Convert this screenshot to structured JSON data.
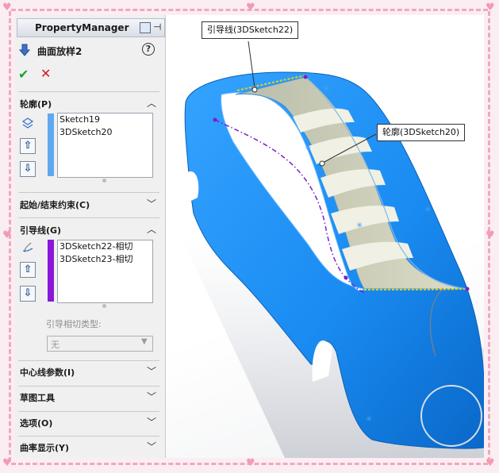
{
  "property_manager": {
    "header_title": "PropertyManager",
    "feature_name": "曲面放样2",
    "help_icon": "?",
    "ok_icon": "✔",
    "cancel_icon": "✕"
  },
  "sections": {
    "profiles": {
      "title": "轮廓(P)",
      "items": [
        "Sketch19",
        "3DSketch20"
      ]
    },
    "start_end_constraints": {
      "title": "起始/结束约束(C)"
    },
    "guide_curves": {
      "title": "引导线(G)",
      "items": [
        "3DSketch22-相切",
        "3DSketch23-相切"
      ],
      "tangency_label": "引导相切类型:",
      "tangency_value": "无"
    },
    "centerline": {
      "title": "中心线参数(I)"
    },
    "sketch_tools": {
      "title": "草图工具"
    },
    "options": {
      "title": "选项(O)"
    },
    "curvature_display": {
      "title": "曲率显示(Y)"
    }
  },
  "callouts": {
    "guide": "引导线(3DSketch22)",
    "profile": "轮廓(3DSketch20)"
  },
  "icons": {
    "feature": "loft-surface-icon",
    "pin": "pushpin-icon",
    "up": "move-up-icon",
    "down": "move-down-icon"
  },
  "colors": {
    "profile_bar": "#5fa8ef",
    "guide_bar": "#8a17d9",
    "model_blue": "#1a8cf2",
    "border_dash": "#f0a8bf"
  }
}
